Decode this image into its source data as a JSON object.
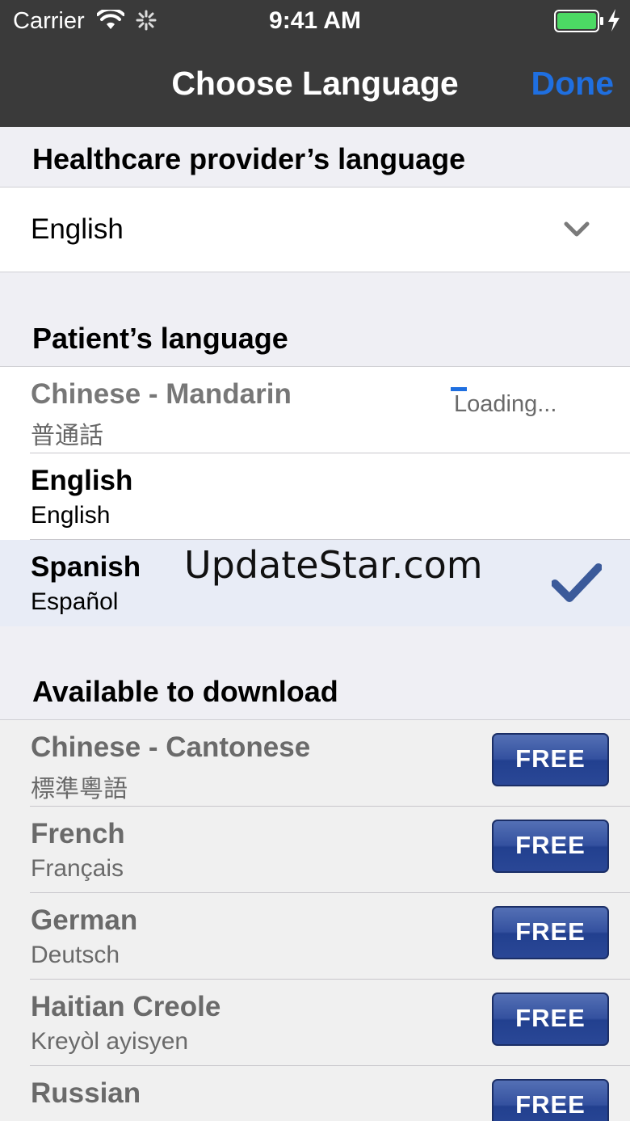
{
  "status_bar": {
    "carrier": "Carrier",
    "time": "9:41 AM",
    "wifi_icon": "wifi-icon",
    "activity_icon": "activity-spinner-icon",
    "battery_icon": "battery-icon",
    "charging_icon": "charging-bolt-icon"
  },
  "nav": {
    "title": "Choose Language",
    "done_label": "Done"
  },
  "provider": {
    "header": "Healthcare provider’s language",
    "selected": "English",
    "icon": "chevron-down-icon"
  },
  "patient": {
    "header": "Patient’s language",
    "items": [
      {
        "name": "Chinese - Mandarin",
        "native": "普通話",
        "status": "Loading..."
      },
      {
        "name": "English",
        "native": "English"
      },
      {
        "name": "Spanish",
        "native": "Español",
        "selected": true
      }
    ]
  },
  "download": {
    "header": "Available to download",
    "button_label": "FREE",
    "items": [
      {
        "name": "Chinese - Cantonese",
        "native": "標準粵語"
      },
      {
        "name": "French",
        "native": "Français"
      },
      {
        "name": "German",
        "native": "Deutsch"
      },
      {
        "name": "Haitian Creole",
        "native": "Kreyòl ayisyen"
      },
      {
        "name": "Russian",
        "native": ""
      }
    ]
  },
  "watermark": "UpdateStar.com",
  "colors": {
    "nav_bg": "#3a3a3a",
    "accent": "#1f6fe0",
    "button": "#2a4796",
    "check": "#3b5a9a"
  }
}
